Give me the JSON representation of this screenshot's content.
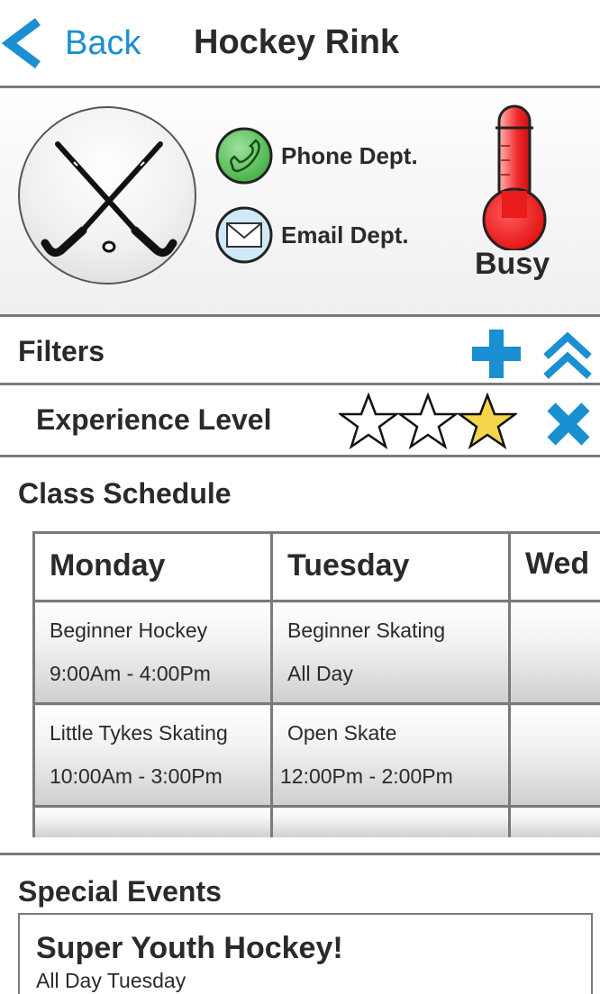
{
  "header": {
    "back_label": "Back",
    "title": "Hockey Rink",
    "back_icon": "chevron-left-icon"
  },
  "info": {
    "logo_icon": "crossed-hockey-sticks-icon",
    "contacts": [
      {
        "label": "Phone Dept.",
        "icon": "phone-icon"
      },
      {
        "label": "Email Dept.",
        "icon": "envelope-icon"
      }
    ],
    "status": {
      "label": "Busy",
      "icon": "thermometer-icon",
      "level": 0.75
    }
  },
  "filters": {
    "title": "Filters",
    "add_icon": "plus-icon",
    "collapse_icon": "double-chevron-up-icon",
    "experience": {
      "label": "Experience Level",
      "rating": 1,
      "max": 3,
      "remove_icon": "close-icon"
    }
  },
  "schedule": {
    "title": "Class Schedule",
    "days": [
      "Monday",
      "Tuesday",
      "Wed"
    ],
    "rows": [
      [
        {
          "name": "Beginner Hockey",
          "time": "9:00Am - 4:00Pm"
        },
        {
          "name": "Beginner Skating",
          "time": "All Day"
        },
        {
          "name": "",
          "time": ""
        }
      ],
      [
        {
          "name": "Little Tykes Skating",
          "time": "10:00Am - 3:00Pm"
        },
        {
          "name": "Open Skate",
          "time": "12:00Pm - 2:00Pm"
        },
        {
          "name": "",
          "time": ""
        }
      ]
    ]
  },
  "events": {
    "title": "Special Events",
    "items": [
      {
        "name": "Super Youth Hockey!",
        "when": "All Day Tuesday"
      }
    ]
  },
  "colors": {
    "accent": "#1a8fd1",
    "divider": "#7a7a7a",
    "star_filled": "#f5d64a",
    "thermometer": "#e8171a",
    "phone_green": "#5cc45c",
    "email_blue": "#cfe9f7"
  }
}
